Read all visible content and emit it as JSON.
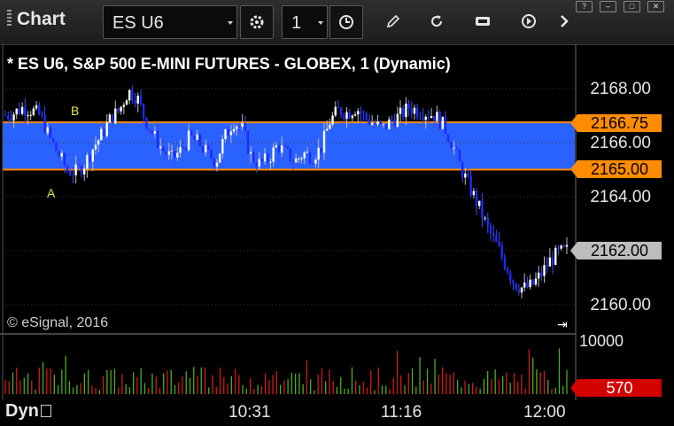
{
  "app": {
    "title": "Chart"
  },
  "toolbar": {
    "symbol": "ES U6",
    "interval": "1",
    "icons": [
      "gear-icon",
      "clock-icon",
      "pencil-icon",
      "refresh-icon",
      "get-icon",
      "play-icon",
      "chevron-right-icon"
    ]
  },
  "window_controls": [
    "help-icon",
    "minimize-icon",
    "maximize-icon",
    "close-icon"
  ],
  "chart": {
    "title": "* ES U6, S&P 500 E-MINI FUTURES - GLOBEX, 1 (Dynamic)",
    "copyright": "© eSignal, 2016",
    "price_axis": [
      "2168.00",
      "2166.00",
      "2164.00",
      "2162.00",
      "2160.00"
    ],
    "tags": {
      "upper": "2166.75",
      "lower": "2165.00",
      "last": "2162.00",
      "volume": "570"
    },
    "markers": {
      "a": "A",
      "b": "B"
    },
    "volume_axis": "10000",
    "time_axis": [
      "10:31",
      "11:16",
      "12:00"
    ],
    "dyn_label": "Dyn",
    "colors": {
      "band": "#2a62ff",
      "band_edge": "#ff8c00",
      "up_bar": "#ffffff",
      "down_bar": "#1a2cff",
      "vol_up": "#4caf1a",
      "vol_down": "#d41a1a"
    }
  },
  "chart_data": {
    "type": "candlestick",
    "y_range": [
      2159.5,
      2169.0
    ],
    "band": [
      2165.0,
      2166.75
    ],
    "last_price": 2162.0,
    "close_path": [
      2167.0,
      2167.1,
      2167.3,
      2167.2,
      2167.0,
      2166.2,
      2165.6,
      2165.0,
      2164.9,
      2165.2,
      2165.8,
      2166.3,
      2166.9,
      2167.2,
      2167.9,
      2167.7,
      2166.8,
      2166.2,
      2165.7,
      2165.4,
      2165.7,
      2166.2,
      2166.0,
      2165.6,
      2165.3,
      2166.2,
      2166.8,
      2166.5,
      2165.5,
      2165.2,
      2165.4,
      2165.9,
      2165.6,
      2165.3,
      2165.6,
      2165.5,
      2165.8,
      2166.8,
      2167.2,
      2167.1,
      2167.3,
      2166.9,
      2166.7,
      2166.5,
      2166.8,
      2167.0,
      2167.3,
      2167.2,
      2167.1,
      2167.0,
      2166.6,
      2165.9,
      2165.0,
      2164.3,
      2163.6,
      2162.8,
      2162.2,
      2161.5,
      2160.8,
      2160.6,
      2160.7,
      2161.1,
      2161.6,
      2161.9,
      2162.0
    ],
    "volume_max": 10000,
    "last_volume": 570
  }
}
